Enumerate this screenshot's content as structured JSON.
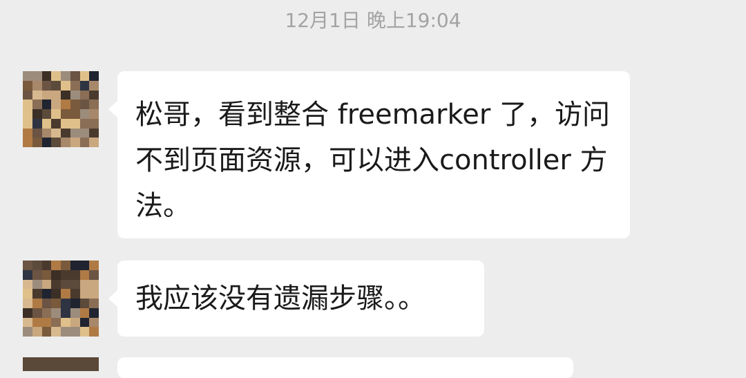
{
  "chat": {
    "timestamp": "12月1日 晚上19:04",
    "messages": [
      {
        "sender": "contact",
        "text": "松哥，看到整合 freemarker 了，访问不到页面资源，可以进入controller 方法。"
      },
      {
        "sender": "contact",
        "text": "我应该没有遗漏步骤。。"
      }
    ]
  },
  "colors": {
    "background": "#ededed",
    "bubble": "#ffffff",
    "timestamp_text": "#a3a3a3",
    "message_text": "#1a1a1a"
  }
}
